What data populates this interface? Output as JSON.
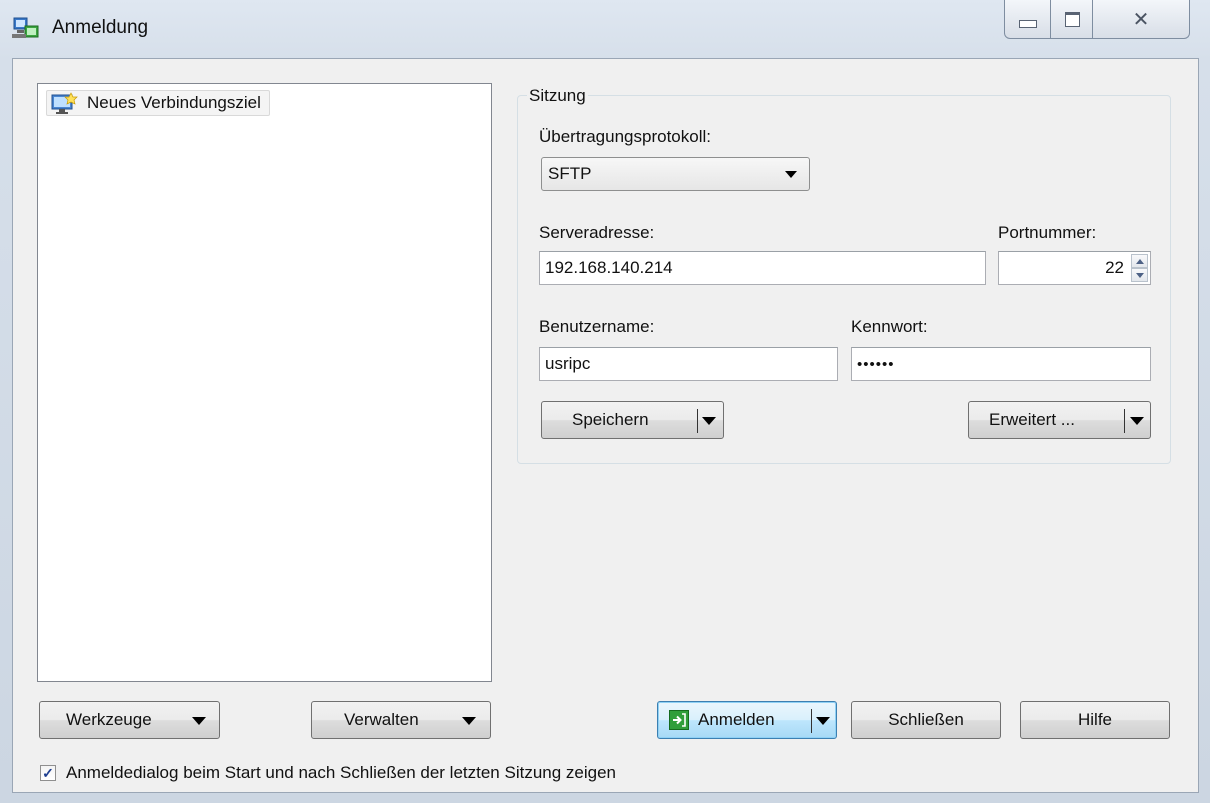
{
  "window": {
    "title": "Anmeldung",
    "close_glyph": "☒",
    "close_symbol": "✕"
  },
  "tree": {
    "items": [
      {
        "label": "Neues Verbindungsziel",
        "icon": "new-site-computer-icon"
      }
    ]
  },
  "session": {
    "legend": "Sitzung",
    "protocol_label": "Übertragungsprotokoll:",
    "protocol_value": "SFTP",
    "server_label": "Serveradresse:",
    "server_value": "192.168.140.214",
    "port_label": "Portnummer:",
    "port_value": "22",
    "user_label": "Benutzername:",
    "user_value": "usripc",
    "password_label": "Kennwort:",
    "password_value": "••••••",
    "save_label": "Speichern",
    "advanced_label": "Erweitert ..."
  },
  "footer": {
    "tools_label": "Werkzeuge",
    "manage_label": "Verwalten",
    "login_label": "Anmelden",
    "close_label": "Schließen",
    "help_label": "Hilfe",
    "checkbox_label": "Anmeldedialog beim Start und nach Schließen der letzten Sitzung zeigen",
    "checkbox_checked": true
  },
  "colors": {
    "accent": "#3c7fb1",
    "login_icon": "#2f9e3a"
  }
}
